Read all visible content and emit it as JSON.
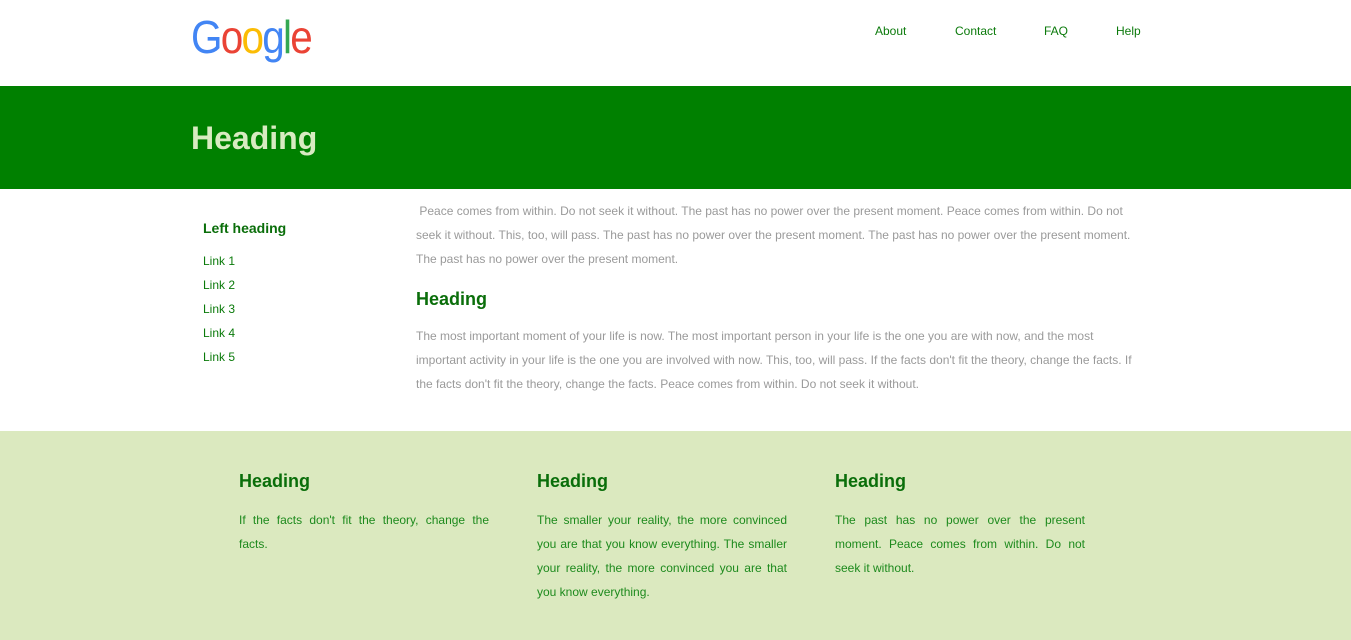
{
  "header": {
    "logo_text": "Google",
    "logo_colors": [
      "#4285F4",
      "#EA4335",
      "#FBBC05",
      "#4285F4",
      "#34A853",
      "#EA4335"
    ],
    "nav": [
      {
        "label": "About"
      },
      {
        "label": "Contact"
      },
      {
        "label": "FAQ"
      },
      {
        "label": "Help"
      }
    ]
  },
  "hero": {
    "title": "Heading"
  },
  "sidebar": {
    "heading": "Left heading",
    "links": [
      {
        "label": "Link 1"
      },
      {
        "label": "Link 2"
      },
      {
        "label": "Link 3"
      },
      {
        "label": "Link 4"
      },
      {
        "label": "Link 5"
      }
    ]
  },
  "main": {
    "intro": " Peace comes from within. Do not seek it without. The past has no power over the present moment. Peace comes from within. Do not seek it without. This, too, will pass. The past has no power over the present moment. The past has no power over the present moment. The past has no power over the present moment.",
    "heading": "Heading",
    "body": "The most important moment of your life is now. The most important person in your life is the one you are with now, and the most important activity in your life is the one you are involved with now. This, too, will pass. If the facts don't fit the theory, change the facts. If the facts don't fit the theory, change the facts. Peace comes from within. Do not seek it without."
  },
  "footer": {
    "columns": [
      {
        "heading": "Heading",
        "text": "If the facts don't fit the theory, change the facts."
      },
      {
        "heading": "Heading",
        "text": "The smaller your reality, the more convinced you are that you know everything. The smaller your reality, the more convinced you are that you know everything."
      },
      {
        "heading": "Heading",
        "text": "The past has no power over the present moment. Peace comes from within. Do not seek it without."
      }
    ]
  },
  "colors": {
    "hero_bg": "#008000",
    "hero_text": "#d8ebc1",
    "footer_bg": "#dbe9bf",
    "accent_green": "#0a6e0a",
    "body_text_gray": "#9a9a9a"
  }
}
